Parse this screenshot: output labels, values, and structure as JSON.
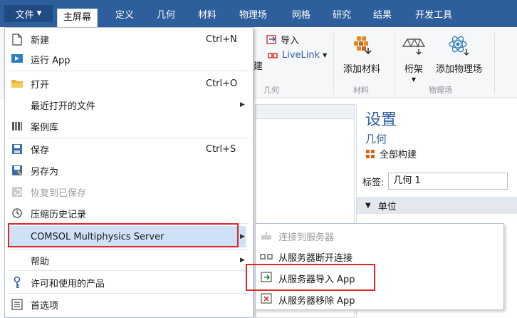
{
  "ribbon_tabs": {
    "file": "文件",
    "home": "主屏幕",
    "definitions": "定义",
    "geometry": "几何",
    "materials": "材料",
    "physics": "物理场",
    "mesh": "网格",
    "study": "研究",
    "results": "结果",
    "developer": "开发工具"
  },
  "ribbon": {
    "import_label": "导入",
    "livelink_label": "LiveLink",
    "partial_label": "建",
    "add_material": "添加材料",
    "truss": "桁架",
    "add_physics": "添加物理场",
    "group_geometry": "几何",
    "group_materials": "材料",
    "group_physics": "物理场"
  },
  "file_menu": {
    "items": [
      {
        "label": "新建",
        "shortcut": "Ctrl+N",
        "icon": "new-file-icon"
      },
      {
        "label": "运行 App",
        "icon": "run-app-icon"
      },
      {
        "label": "打开",
        "shortcut": "Ctrl+O",
        "icon": "open-folder-icon"
      },
      {
        "label": "最近打开的文件",
        "icon": "none"
      },
      {
        "label": "案例库",
        "icon": "library-icon"
      },
      {
        "label": "保存",
        "shortcut": "Ctrl+S",
        "icon": "save-icon"
      },
      {
        "label": "另存为",
        "icon": "save-as-icon"
      },
      {
        "label": "恢复到已保存",
        "icon": "revert-icon"
      },
      {
        "label": "压缩历史记录",
        "icon": "compact-history-icon"
      },
      {
        "label": "COMSOL Multiphysics Server",
        "icon": "none"
      },
      {
        "label": "帮助",
        "icon": "none"
      },
      {
        "label": "许可和使用的产品",
        "icon": "license-icon"
      },
      {
        "label": "首选项",
        "icon": "preferences-icon"
      }
    ]
  },
  "server_submenu": {
    "items": [
      {
        "label": "连接到服务器",
        "icon": "connect-server-icon"
      },
      {
        "label": "从服务器断开连接",
        "icon": "disconnect-server-icon"
      },
      {
        "label": "从服务器导入 App",
        "icon": "import-app-icon"
      },
      {
        "label": "从服务器移除 App",
        "icon": "remove-app-icon"
      }
    ]
  },
  "settings": {
    "title": "设置",
    "subtitle": "几何",
    "build_all": "全部构建",
    "label_caption": "标签:",
    "label_value": "几何 1",
    "units_section": "单位"
  },
  "colors": {
    "ribbon_blue": "#2e5f9c",
    "highlight_red": "#e0262a",
    "menu_hover": "#cfe1f7"
  }
}
